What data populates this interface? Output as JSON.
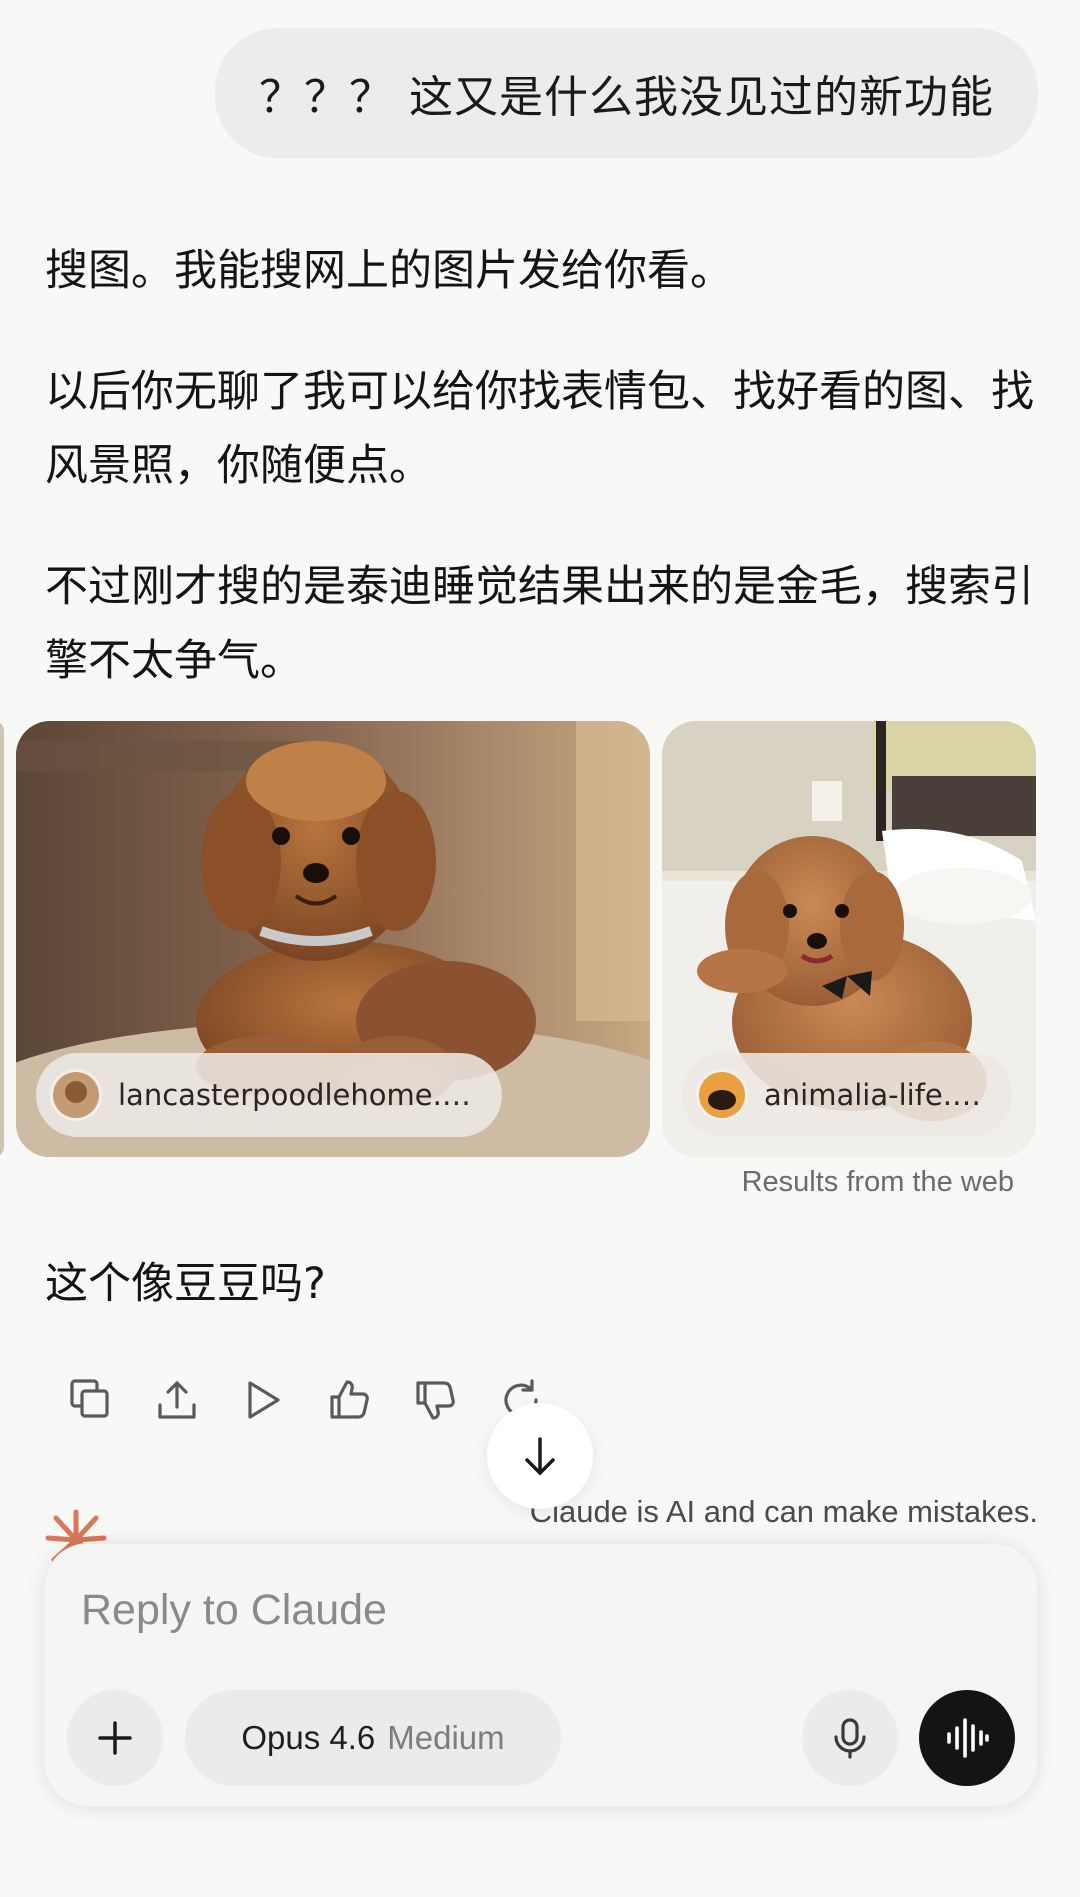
{
  "user_message": "？？？ 这又是什么我没见过的新功能",
  "assistant": {
    "paragraphs": [
      "搜图。我能搜网上的图片发给你看。",
      "以后你无聊了我可以给你找表情包、找好看的图、找风景照，你随便点。",
      "不过刚才搜的是泰迪睡觉结果出来的是金毛，搜索引擎不太争气。"
    ],
    "image_results": [
      {
        "source": "lancasterpoodlehome.com",
        "icon": "site-favicon"
      },
      {
        "source": "animalia-life.cl…",
        "icon": "site-favicon"
      }
    ],
    "results_note": "Results from the web",
    "followup": "这个像豆豆吗?"
  },
  "actions": [
    {
      "name": "copy-icon"
    },
    {
      "name": "share-icon"
    },
    {
      "name": "play-icon"
    },
    {
      "name": "thumbs-up-icon"
    },
    {
      "name": "thumbs-down-icon"
    },
    {
      "name": "retry-icon"
    }
  ],
  "disclaimer": "Claude is AI and can make mistakes.",
  "composer": {
    "placeholder": "Reply to Claude",
    "model": "Opus 4.6",
    "effort": "Medium"
  },
  "colors": {
    "background": "#f8f8f7",
    "accent_spark": "#d97757",
    "voice_button": "#141414"
  }
}
